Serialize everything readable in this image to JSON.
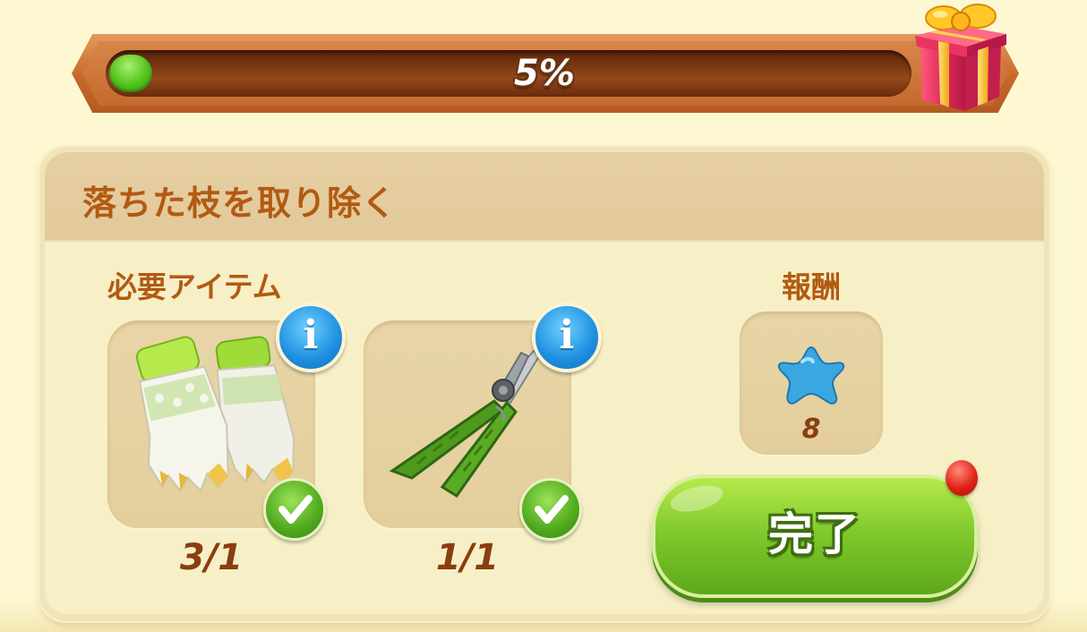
{
  "progress": {
    "percent_text": "5%",
    "fraction": 0.05,
    "gift_icon": "gift-box-icon"
  },
  "task": {
    "title": "落ちた枝を取り除く",
    "required_label": "必要アイテム",
    "reward_label": "報酬",
    "items": [
      {
        "name": "gardening-gloves",
        "icon": "gloves-icon",
        "count": "3/1",
        "complete": true
      },
      {
        "name": "pruning-shears",
        "icon": "pruning-shears-icon",
        "count": "1/1",
        "complete": true
      }
    ],
    "reward": {
      "icon": "blue-star-icon",
      "value": "8"
    },
    "complete_button": "完了"
  },
  "colors": {
    "title_text": "#b25a12",
    "progress_fill": "#52c21b",
    "button_green": "#7cc72a",
    "info_blue": "#1e8fe0",
    "notify_red": "#e02314"
  }
}
